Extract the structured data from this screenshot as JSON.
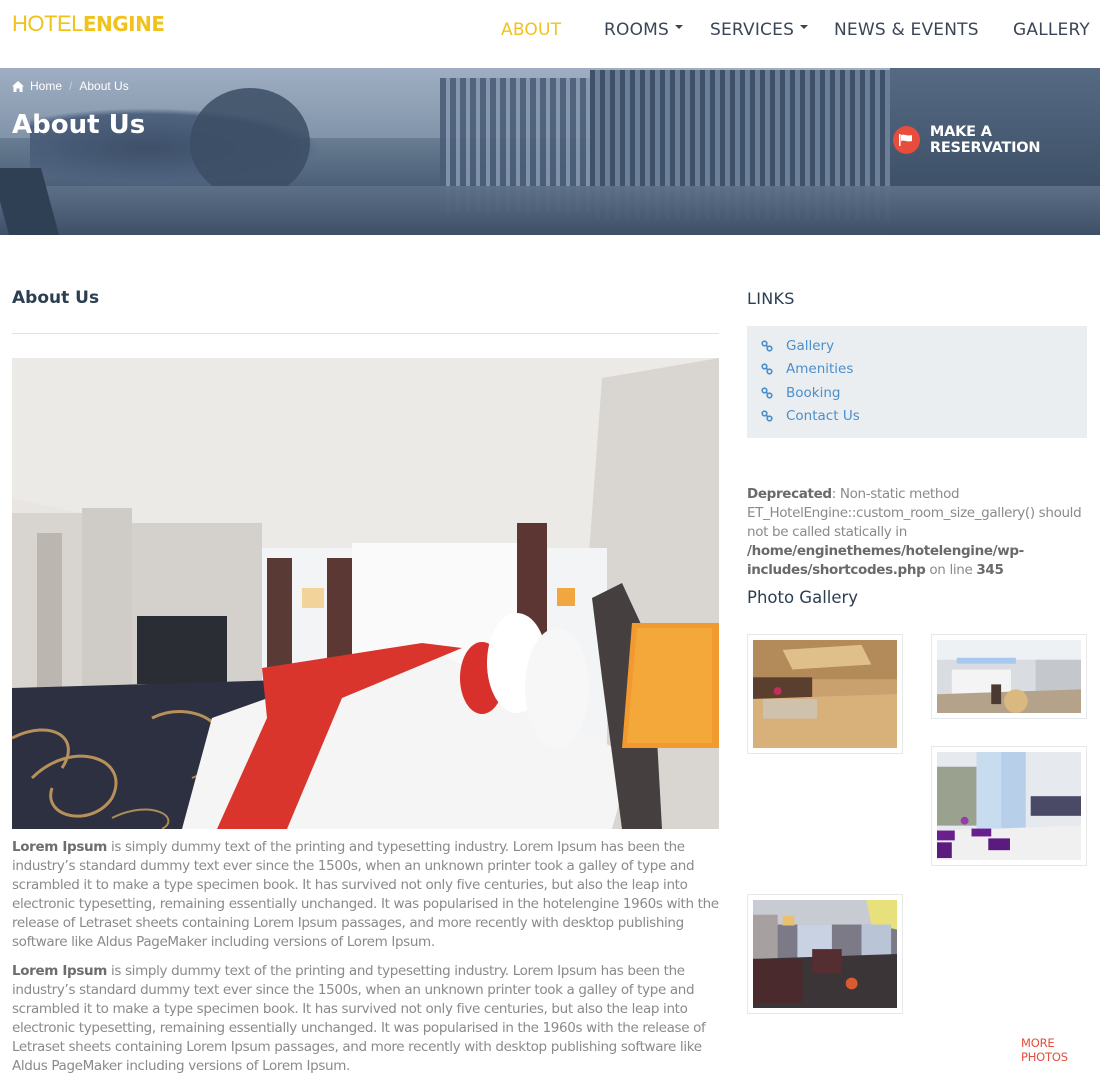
{
  "header": {
    "logo_light": "HOTEL",
    "logo_bold": "ENGINE",
    "brand_color": "#f1c21b",
    "nav": [
      {
        "label": "ABOUT",
        "active": true,
        "dropdown": false
      },
      {
        "label": "ROOMS",
        "active": false,
        "dropdown": true
      },
      {
        "label": "SERVICES",
        "active": false,
        "dropdown": true
      },
      {
        "label": "NEWS & EVENTS",
        "active": false,
        "dropdown": false
      },
      {
        "label": "GALLERY",
        "active": false,
        "dropdown": false
      }
    ]
  },
  "banner": {
    "breadcrumb": {
      "home_icon": "home-icon",
      "home_label": "Home",
      "separator": "/",
      "current": "About Us"
    },
    "title": "About Us",
    "reservation": {
      "icon": "flag-icon",
      "label": "MAKE A RESERVATION",
      "accent_color": "#e74c3c"
    }
  },
  "main": {
    "heading": "About Us",
    "hero_image": "hotel-bedroom-photo",
    "paragraphs": [
      {
        "bold": "Lorem Ipsum",
        "text": " is simply dummy text of the printing and typesetting industry. Lorem Ipsum has been the industry’s standard dummy text ever since the 1500s, when an unknown printer took a galley of type and scrambled it to make a type specimen book. It has survived not only five centuries, but also the leap into electronic typesetting, remaining essentially unchanged. It was popularised in the hotelengine 1960s with the release of Letraset sheets containing Lorem Ipsum passages, and more recently with desktop publishing software like Aldus PageMaker including versions of Lorem Ipsum."
      },
      {
        "bold": "Lorem Ipsum",
        "text": " is simply dummy text of the printing and typesetting industry. Lorem Ipsum has been the industry’s standard dummy text ever since the 1500s, when an unknown printer took a galley of type and scrambled it to make a type specimen book. It has survived not only five centuries, but also the leap into electronic typesetting, remaining essentially unchanged. It was popularised in the 1960s with the release of Letraset sheets containing Lorem Ipsum passages, and more recently with desktop publishing software like Aldus PageMaker including versions of Lorem Ipsum."
      }
    ]
  },
  "sidebar": {
    "links_title": "LINKS",
    "links": [
      {
        "label": "Gallery",
        "icon": "link-icon"
      },
      {
        "label": "Amenities",
        "icon": "link-icon"
      },
      {
        "label": "Booking",
        "icon": "link-icon"
      },
      {
        "label": "Contact Us",
        "icon": "link-icon"
      }
    ],
    "link_color": "#4a8fcb",
    "deprecated": {
      "label": "Deprecated",
      "message": ": Non-static method ET_HotelEngine::custom_room_size_gallery() should not be called statically in ",
      "path": "/home/enginethemes/hotelengine/wp-includes/shortcodes.php",
      "on_line": " on line ",
      "line": "345"
    },
    "gallery_title": "Photo Gallery",
    "gallery": [
      {
        "name": "lobby-reception-photo"
      },
      {
        "name": "restaurant-buffet-photo"
      },
      {
        "name": "lounge-purple-seating-photo"
      },
      {
        "name": "suite-living-room-photo"
      }
    ],
    "more_photos": "MORE PHOTOS"
  }
}
